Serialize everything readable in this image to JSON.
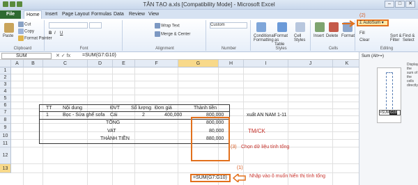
{
  "window": {
    "title": "TÂN TẠO a.xls [Compatibility Mode] - Microsoft Excel"
  },
  "tabs": [
    "File",
    "Home",
    "Insert",
    "Page Layout",
    "Formulas",
    "Data",
    "Review",
    "View"
  ],
  "ribbon": {
    "clipboard": {
      "paste": "Paste",
      "cut": "Cut",
      "copy": "Copy",
      "format_painter": "Format Painter",
      "label": "Clipboard"
    },
    "font": {
      "label": "Font"
    },
    "alignment": {
      "wrap": "Wrap Text",
      "merge": "Merge & Center",
      "label": "Alignment"
    },
    "number": {
      "format": "Custom",
      "label": "Number"
    },
    "styles": {
      "conditional": "Conditional Formatting",
      "format_table": "Format as Table",
      "cell_styles": "Cell Styles",
      "label": "Styles"
    },
    "cells": {
      "insert": "Insert",
      "delete": "Delete",
      "format": "Format",
      "label": "Cells"
    },
    "editing": {
      "autosum": "AutoSum",
      "fill": "Fill",
      "clear": "Clear",
      "sort": "Sort & Filter",
      "find": "Find & Select",
      "label": "Editing"
    }
  },
  "annotations": {
    "n1": "(1)",
    "n2": "(2)",
    "n3": "(3)"
  },
  "formula_bar": {
    "name_box": "SUM",
    "icons": "✕ ✓ fx",
    "formula": "=SUM(G7:G10)"
  },
  "columns": [
    "A",
    "B",
    "C",
    "D",
    "E",
    "F",
    "G",
    "H",
    "I",
    "J",
    "K"
  ],
  "rows": [
    "1",
    "2",
    "3",
    "4",
    "5",
    "6",
    "7",
    "8",
    "9",
    "10",
    "11",
    "12",
    "13"
  ],
  "table": {
    "headers": {
      "tt": "TT",
      "noidung": "Nội dung",
      "dvt": "ĐVT",
      "soluong": "Số lượng",
      "dongia": "Đơn giá",
      "thanhtien": "Thành tiền"
    },
    "row7": {
      "tt": "1",
      "noidung": "Bọc - Sửa ghế sofa",
      "dvt": "Cái",
      "soluong": "2",
      "dongia": "400,000",
      "thanhtien": "800,000"
    },
    "tong": {
      "label": "TỔNG",
      "value": "800,000"
    },
    "vat": {
      "label": "VAT",
      "value": "80,000"
    },
    "thanhtien": {
      "label": "THÀNH TIỀN",
      "value": "880,000"
    }
  },
  "side_text": {
    "xuat": "xuất AN NAM 1-11",
    "tmck": "TM/CK",
    "chon": "Chọn dữ liệu tính tổng",
    "nhap": "Nhập vào ô muốn hiển thị tính tổng"
  },
  "g13_formula": "=SUM(G7:G10)",
  "side_panel": {
    "title": "Sum (Alt+=)",
    "desc": "Display the sum of the cells directly",
    "formula": "=SUM",
    "tip": "G10"
  }
}
